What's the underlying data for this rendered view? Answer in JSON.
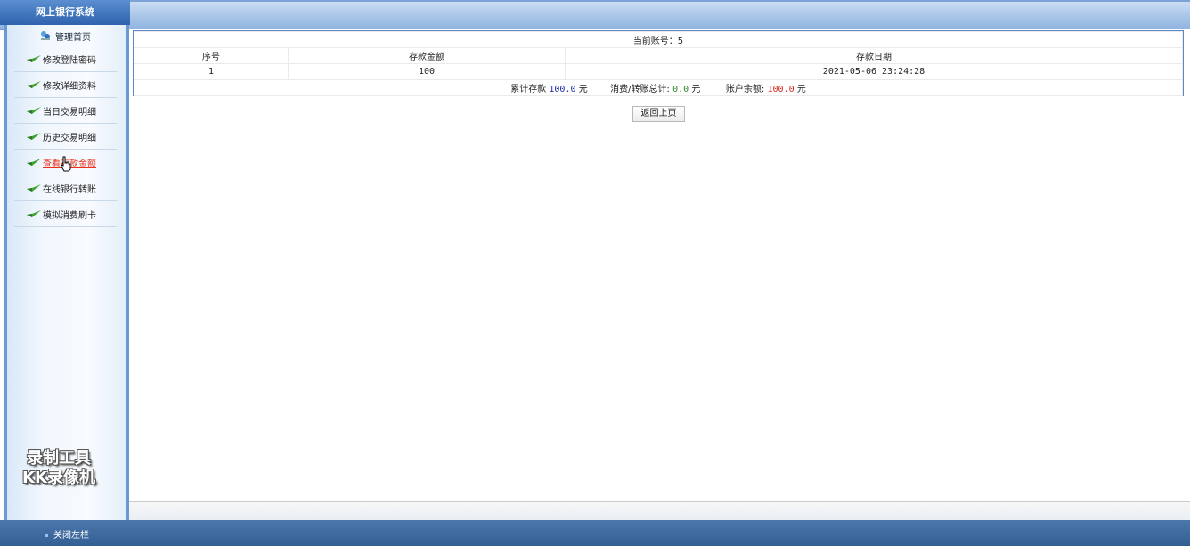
{
  "header": {
    "title": "网上银行系统"
  },
  "sidebar": {
    "home_label": "管理首页",
    "items": [
      {
        "label": "修改登陆密码"
      },
      {
        "label": "修改详细资料"
      },
      {
        "label": "当日交易明细"
      },
      {
        "label": "历史交易明细"
      },
      {
        "label": "查看存款金额",
        "active": true
      },
      {
        "label": "在线银行转账"
      },
      {
        "label": "模拟消费刷卡"
      }
    ]
  },
  "watermark": {
    "line1": "录制工具",
    "line2": "KK录像机"
  },
  "footer": {
    "close_label": "关闭左栏"
  },
  "account": {
    "label": "当前账号：5"
  },
  "table": {
    "headers": [
      "序号",
      "存款金额",
      "存款日期"
    ],
    "rows": [
      {
        "no": "1",
        "amount": "100",
        "date": "2021-05-06 23:24:28"
      }
    ]
  },
  "summary": {
    "deposit_label": "累计存款",
    "deposit_value": "100.0",
    "consume_label": "消费/转账总计:",
    "consume_value": "0.0",
    "balance_label": "账户余额:",
    "balance_value": "100.0",
    "unit": "元"
  },
  "back_button": {
    "label": "返回上页"
  },
  "colors": {
    "deposit": "#1c2ca6",
    "consume": "#2f8a2f",
    "balance": "#d8261c",
    "active_menu": "#e8321c"
  }
}
